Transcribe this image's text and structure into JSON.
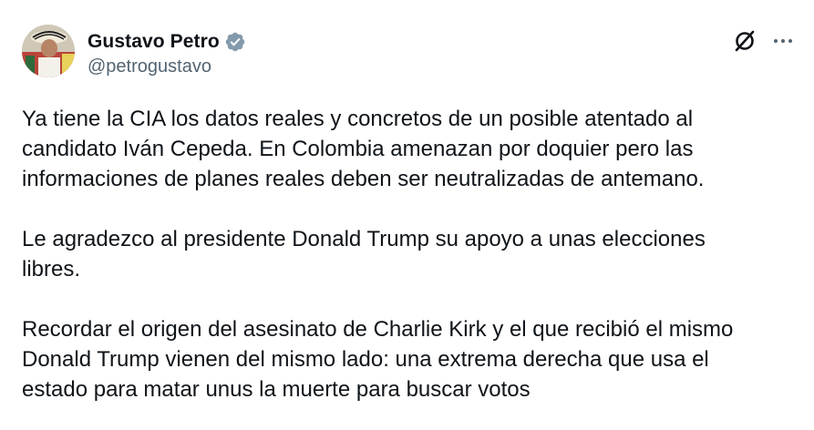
{
  "author": {
    "display_name": "Gustavo Petro",
    "handle": "@petrogustavo",
    "verified_icon": "verified-badge-icon",
    "avatar_icon": "avatar"
  },
  "header_actions": {
    "grok_icon": "grok-icon",
    "more_icon": "more-options-icon"
  },
  "colors": {
    "text": "#0f1419",
    "secondary": "#536471",
    "verified": "#829aab"
  },
  "tweet": {
    "paragraphs": [
      "Ya tiene la CIA los datos reales y concretos de un posible atentado al\ncandidato Iván Cepeda. En Colombia amenazan por doquier pero las\ninformaciones de planes reales deben ser neutralizadas de antemano.",
      "Le agradezco al presidente Donald Trump su apoyo a unas elecciones\nlibres.",
      "Recordar el origen del asesinato de Charlie Kirk y el que recibió el mismo\nDonald Trump vienen del mismo lado: una extrema derecha que usa el\nestado para matar unus la muerte para buscar votos"
    ]
  }
}
